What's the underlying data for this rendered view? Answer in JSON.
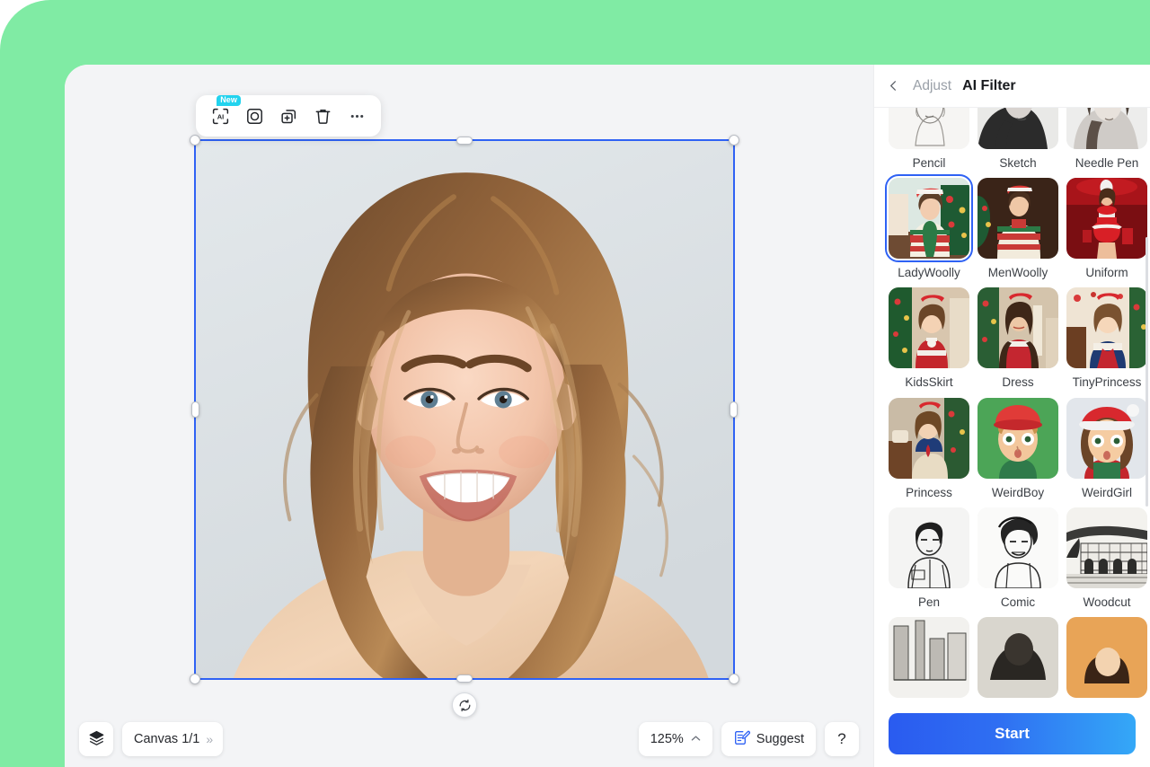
{
  "theme": {
    "backdrop_color": "#80EBA4",
    "app_bg": "#F3F4F6",
    "panel_bg": "#FFFFFF",
    "accent_blue": "#2F62F4",
    "badge_cyan": "#22D3EE"
  },
  "element_toolbar": {
    "buttons": [
      {
        "name": "ai-tool",
        "icon": "ai-brackets-icon",
        "badge": "New"
      },
      {
        "name": "mask-tool",
        "icon": "circle-in-square-icon",
        "badge": ""
      },
      {
        "name": "duplicate-tool",
        "icon": "duplicate-plus-icon",
        "badge": ""
      },
      {
        "name": "delete-tool",
        "icon": "trash-icon",
        "badge": ""
      },
      {
        "name": "more-tool",
        "icon": "ellipsis-icon",
        "badge": ""
      }
    ]
  },
  "canvas": {
    "selected_object": "portrait-image",
    "rotate_handle_icon": "rotate-icon"
  },
  "bottom_bar": {
    "layers_icon": "layers-icon",
    "canvas_label": "Canvas 1/1",
    "canvas_expand_icon": "chevron-double-right-icon",
    "zoom_level": "125%",
    "zoom_caret_icon": "caret-up-icon",
    "suggest_icon": "suggest-edit-icon",
    "suggest_label": "Suggest",
    "help_label": "?"
  },
  "panel": {
    "back_icon": "chevron-left-icon",
    "breadcrumb_parent": "Adjust",
    "breadcrumb_current": "AI Filter",
    "start_label": "Start",
    "selected_filter": "LadyWoolly",
    "filters": [
      {
        "label": "Pencil",
        "style": "pencil"
      },
      {
        "label": "Sketch",
        "style": "sketch"
      },
      {
        "label": "Needle Pen",
        "style": "needle"
      },
      {
        "label": "LadyWoolly",
        "style": "ladywoolly"
      },
      {
        "label": "MenWoolly",
        "style": "menwoolly"
      },
      {
        "label": "Uniform",
        "style": "uniform"
      },
      {
        "label": "KidsSkirt",
        "style": "kidsskirt"
      },
      {
        "label": "Dress",
        "style": "dress"
      },
      {
        "label": "TinyPrincess",
        "style": "tinyprincess"
      },
      {
        "label": "Princess",
        "style": "princess"
      },
      {
        "label": "WeirdBoy",
        "style": "weirdboy"
      },
      {
        "label": "WeirdGirl",
        "style": "weirdgirl"
      },
      {
        "label": "Pen",
        "style": "pen"
      },
      {
        "label": "Comic",
        "style": "comic"
      },
      {
        "label": "Woodcut",
        "style": "woodcut"
      },
      {
        "label": "",
        "style": "partial-grey"
      },
      {
        "label": "",
        "style": "partial-dark"
      },
      {
        "label": "",
        "style": "partial-orange"
      }
    ]
  }
}
